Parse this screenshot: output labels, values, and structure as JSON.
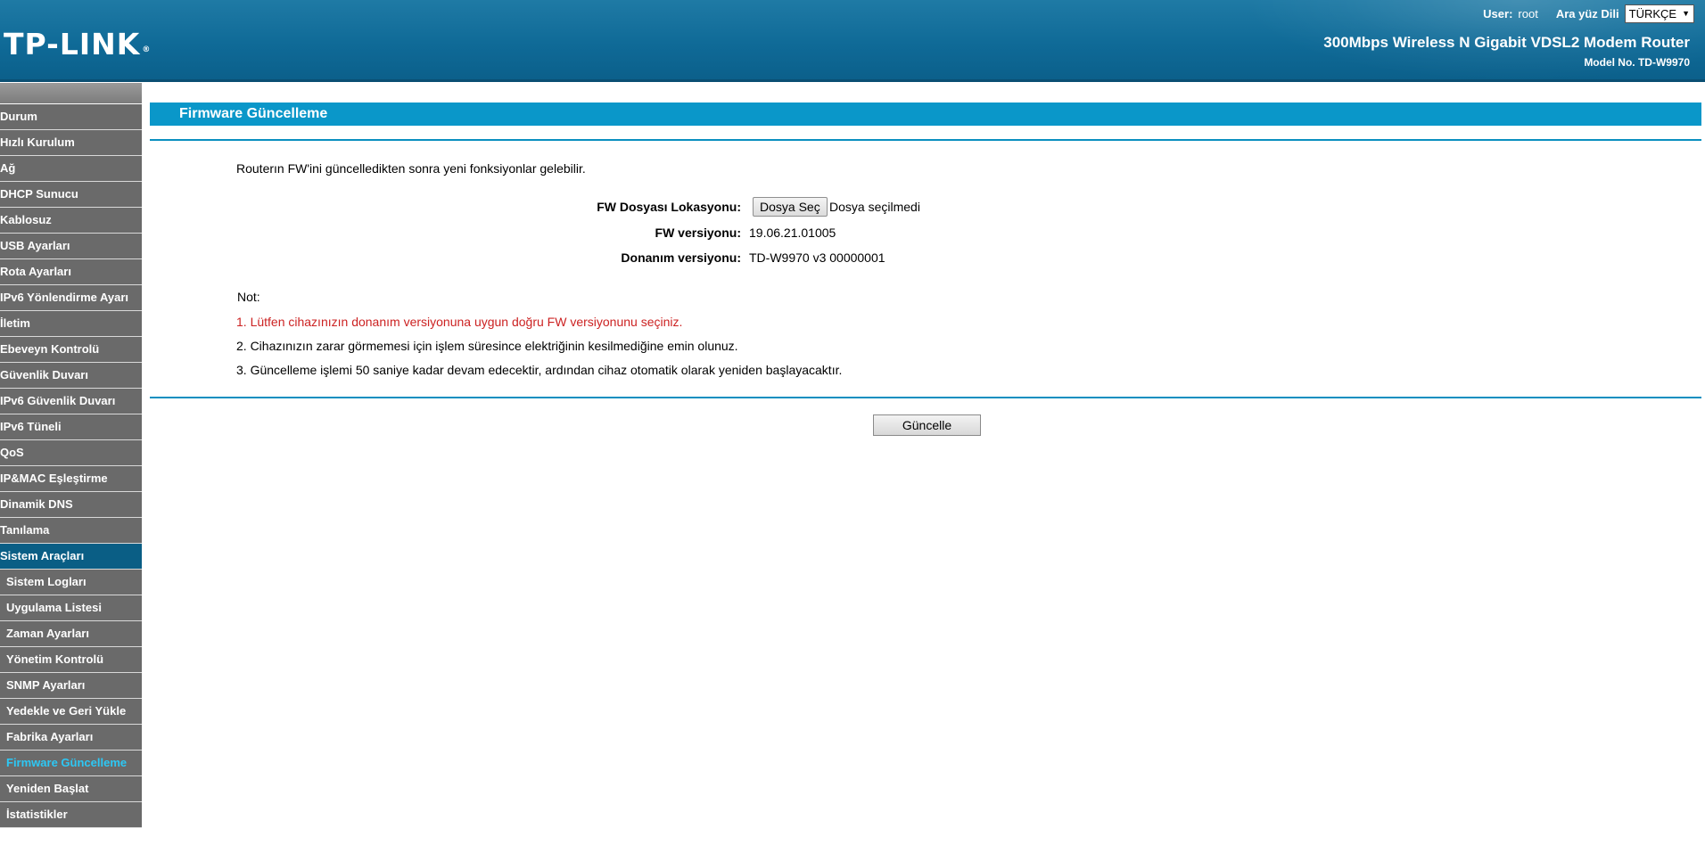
{
  "header": {
    "logo": "TP-LINK",
    "user_label": "User:",
    "user_name": "root",
    "language_label": "Ara yüz Dili",
    "language_selected": "TÜRKÇE",
    "product_name": "300Mbps Wireless N Gigabit VDSL2 Modem Router",
    "model_no": "Model No. TD-W9970"
  },
  "sidebar": {
    "items": [
      {
        "label": "Durum"
      },
      {
        "label": "Hızlı Kurulum"
      },
      {
        "label": "Ağ"
      },
      {
        "label": "DHCP Sunucu"
      },
      {
        "label": "Kablosuz"
      },
      {
        "label": "USB Ayarları"
      },
      {
        "label": "Rota Ayarları"
      },
      {
        "label": "IPv6 Yönlendirme Ayarı"
      },
      {
        "label": "İletim"
      },
      {
        "label": "Ebeveyn Kontrolü"
      },
      {
        "label": "Güvenlik Duvarı"
      },
      {
        "label": "IPv6 Güvenlik Duvarı"
      },
      {
        "label": "IPv6 Tüneli"
      },
      {
        "label": "QoS"
      },
      {
        "label": "IP&MAC Eşleştirme"
      },
      {
        "label": "Dinamik DNS"
      },
      {
        "label": "Tanılama"
      },
      {
        "label": "Sistem Araçları"
      }
    ],
    "sub_items": [
      {
        "label": "Sistem Logları"
      },
      {
        "label": "Uygulama Listesi"
      },
      {
        "label": "Zaman Ayarları"
      },
      {
        "label": "Yönetim Kontrolü"
      },
      {
        "label": "SNMP Ayarları"
      },
      {
        "label": "Yedekle ve Geri Yükle"
      },
      {
        "label": "Fabrika Ayarları"
      },
      {
        "label": "Firmware Güncelleme"
      },
      {
        "label": "Yeniden Başlat"
      },
      {
        "label": "İstatistikler"
      }
    ]
  },
  "main": {
    "title": "Firmware Güncelleme",
    "intro": "Routerın FW'ini güncelledikten sonra yeni fonksiyonlar gelebilir.",
    "file_location_label": "FW Dosyası Lokasyonu:",
    "file_choose_button": "Dosya Seç",
    "file_none": "Dosya seçilmedi",
    "fw_version_label": "FW versiyonu:",
    "fw_version_value": "19.06.21.01005",
    "hw_version_label": "Donanım versiyonu:",
    "hw_version_value": "TD-W9970 v3 00000001",
    "note_title": "Not:",
    "notes": [
      "1. Lütfen cihazınızın donanım versiyonuna uygun doğru FW versiyonunu seçiniz.",
      "2. Cihazınızın zarar görmemesi için işlem süresince elektriğinin kesilmediğine emin olunuz.",
      "3. Güncelleme işlemi 50 saniye kadar devam edecektir, ardından cihaz otomatik olarak yeniden başlayacaktır."
    ],
    "update_button": "Güncelle"
  },
  "colors": {
    "header": "#0f6a97",
    "title_bar": "#0a97c9",
    "nav_bg": "#6a6a6a",
    "nav_open": "#0a5e85",
    "nav_active_text": "#2dc8f5",
    "note_warning": "#cc2222"
  }
}
